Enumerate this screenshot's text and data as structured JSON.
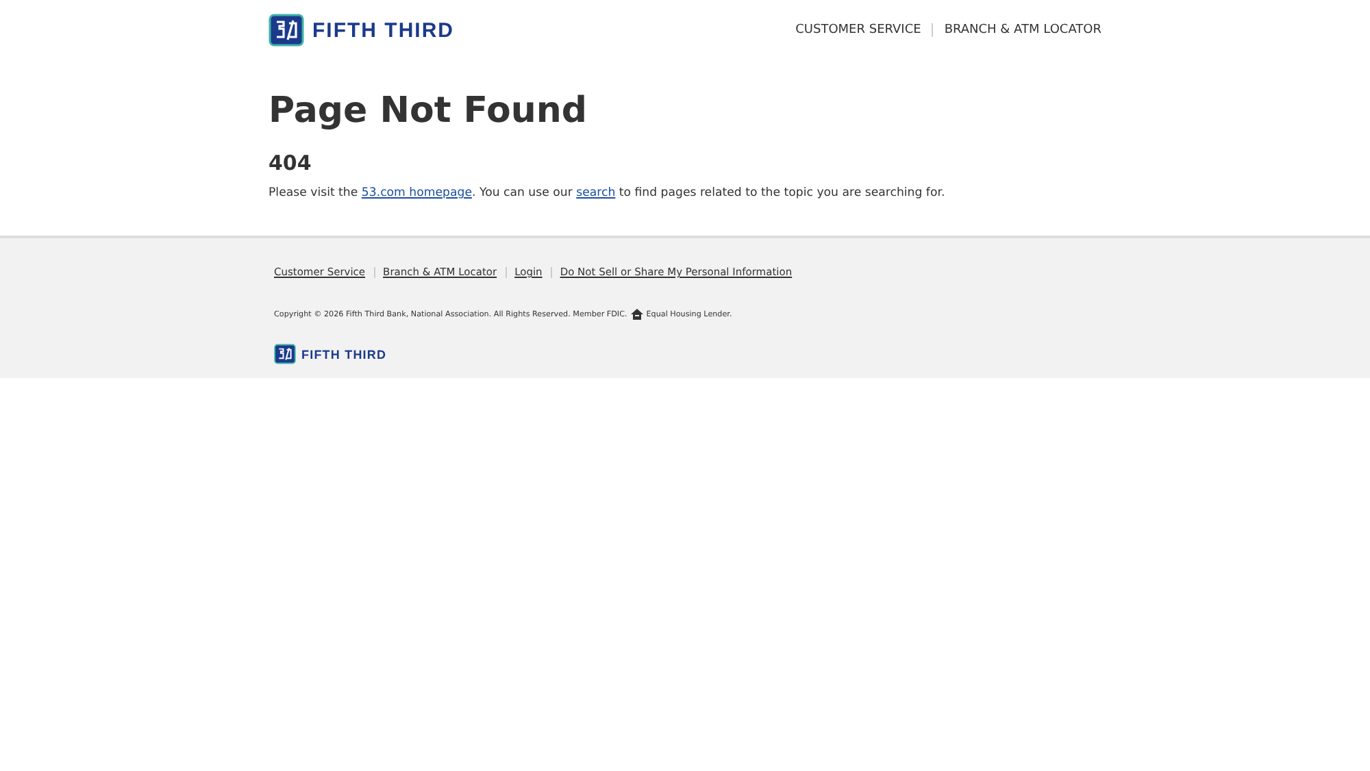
{
  "header": {
    "logo_text": "FIFTH THIRD",
    "nav": [
      "CUSTOMER SERVICE",
      "BRANCH & ATM LOCATOR"
    ]
  },
  "main": {
    "title": "Page Not Found",
    "code": "404",
    "message": [
      {
        "kind": "text",
        "text": "Please visit the "
      },
      {
        "kind": "link",
        "text": "53.com homepage"
      },
      {
        "kind": "text",
        "text": ". You can use our "
      },
      {
        "kind": "link",
        "text": "search"
      },
      {
        "kind": "text",
        "text": " to find pages related to the topic you are searching for."
      }
    ]
  },
  "footer": {
    "links": [
      "Customer Service",
      "Branch & ATM Locator",
      "Login",
      "Do Not Sell or Share My Personal Information"
    ],
    "copyright": "Copyright © 2026 Fifth Third Bank, National Association. All Rights Reserved. Member FDIC.",
    "lender": "Equal Housing Lender.",
    "logo_text": "FIFTH THIRD"
  }
}
